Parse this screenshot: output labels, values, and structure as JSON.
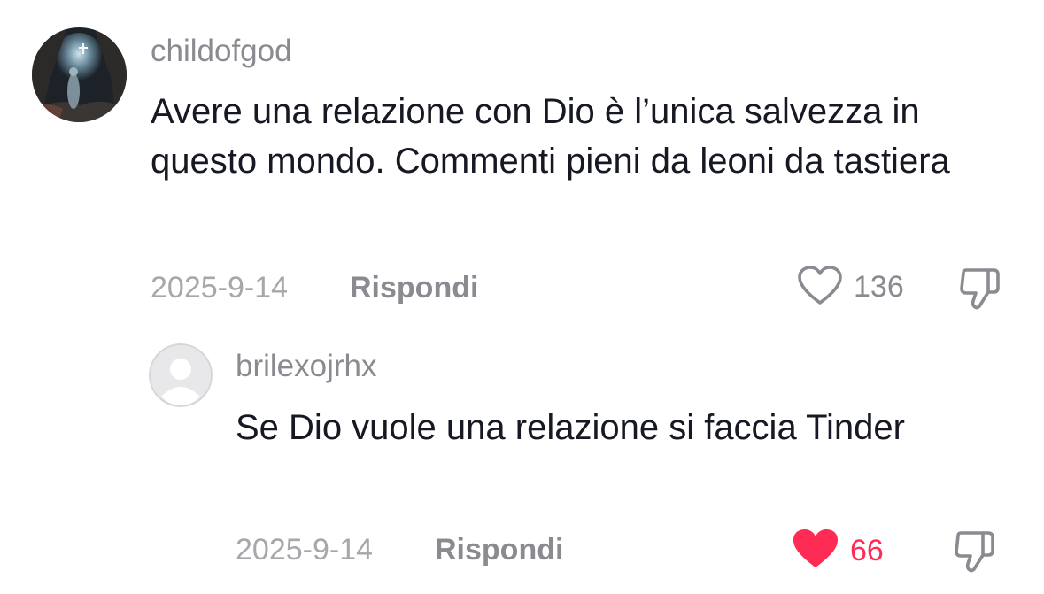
{
  "comments": [
    {
      "username": "childofgod",
      "text": "Avere una relazione con Dio è l’unica salvezza in questo mondo. Commenti pieni da leoni da tastiera",
      "date": "2025-9-14",
      "reply_label": "Rispondi",
      "likes": "136",
      "liked": false
    },
    {
      "username": "brilexojrhx",
      "text": "Se Dio vuole una relazione si faccia Tinder",
      "date": "2025-9-14",
      "reply_label": "Rispondi",
      "likes": "66",
      "liked": true
    }
  ],
  "colors": {
    "like_active": "#fe2c55",
    "meta_gray": "#8a8b91",
    "text": "#161823"
  },
  "icons": {
    "like_inactive": "heart-outline-icon",
    "like_active": "heart-filled-icon",
    "dislike": "thumbs-down-icon",
    "default_avatar": "default-avatar-icon"
  }
}
